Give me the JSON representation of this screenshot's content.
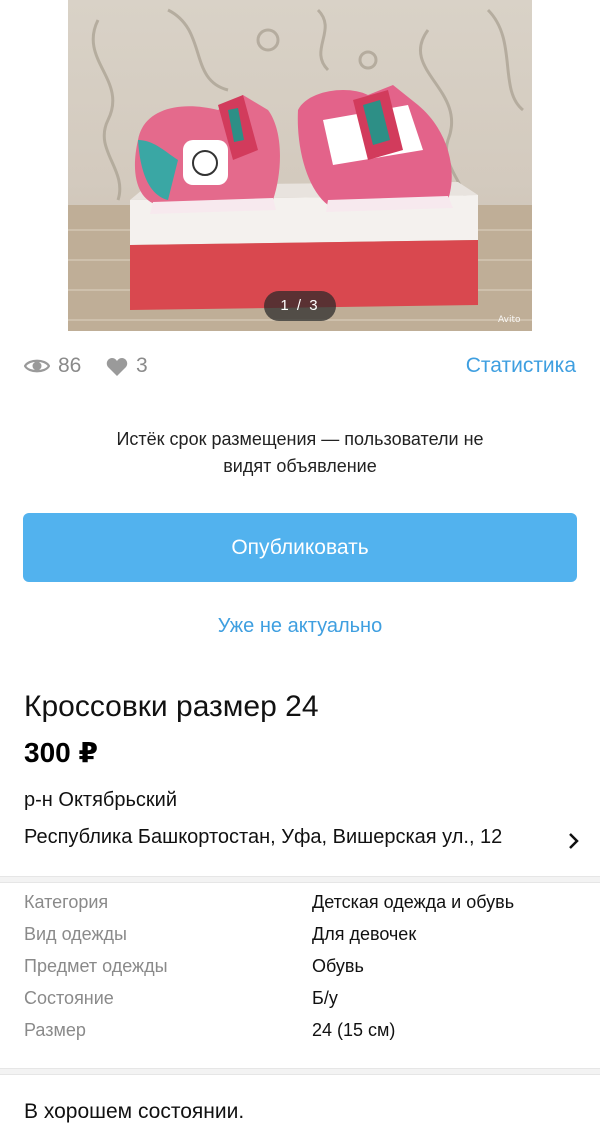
{
  "photo": {
    "counter": "1 / 3",
    "watermark": "Avito"
  },
  "stats": {
    "views": "86",
    "likes": "3",
    "link_label": "Статистика"
  },
  "status": {
    "line1": "Истёк срок размещения — пользователи не",
    "line2": "видят объявление"
  },
  "actions": {
    "publish_label": "Опубликовать",
    "not_actual_label": "Уже не актуально"
  },
  "listing": {
    "title": "Кроссовки размер 24",
    "price": "300 ₽",
    "district": "р-н Октябрьский",
    "address": "Республика Башкортостан, Уфа, Вишерская ул., 12"
  },
  "params": [
    {
      "key": "Категория",
      "value": "Детская одежда и обувь"
    },
    {
      "key": "Вид одежды",
      "value": "Для девочек"
    },
    {
      "key": "Предмет одежды",
      "value": "Обувь"
    },
    {
      "key": "Состояние",
      "value": "Б/у"
    },
    {
      "key": "Размер",
      "value": "24 (15 см)"
    }
  ],
  "description": "В хорошем состоянии.",
  "colors": {
    "accent": "#3f9fe0",
    "button": "#52b2ee",
    "muted": "#8a8a8a"
  }
}
